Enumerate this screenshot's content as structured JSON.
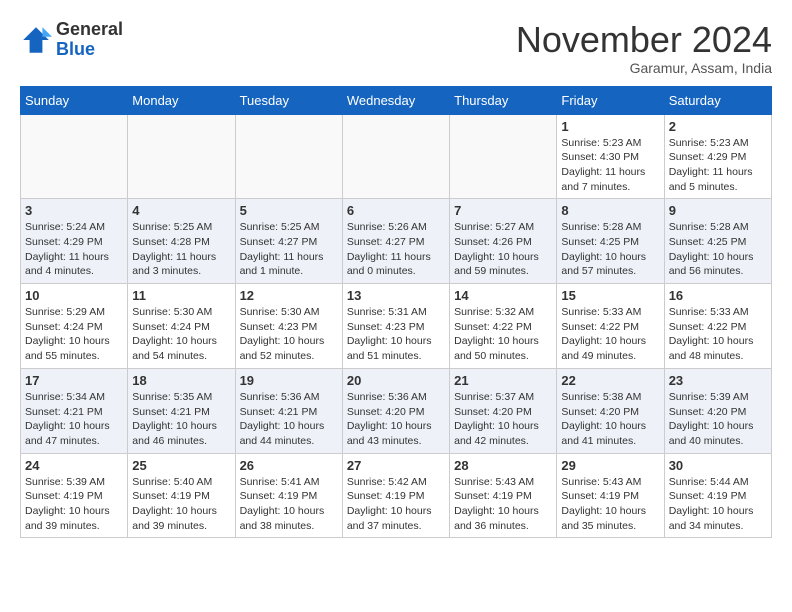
{
  "header": {
    "month_year": "November 2024",
    "location": "Garamur, Assam, India"
  },
  "columns": [
    "Sunday",
    "Monday",
    "Tuesday",
    "Wednesday",
    "Thursday",
    "Friday",
    "Saturday"
  ],
  "weeks": [
    [
      {
        "day": "",
        "info": ""
      },
      {
        "day": "",
        "info": ""
      },
      {
        "day": "",
        "info": ""
      },
      {
        "day": "",
        "info": ""
      },
      {
        "day": "",
        "info": ""
      },
      {
        "day": "1",
        "info": "Sunrise: 5:23 AM\nSunset: 4:30 PM\nDaylight: 11 hours and 7 minutes."
      },
      {
        "day": "2",
        "info": "Sunrise: 5:23 AM\nSunset: 4:29 PM\nDaylight: 11 hours and 5 minutes."
      }
    ],
    [
      {
        "day": "3",
        "info": "Sunrise: 5:24 AM\nSunset: 4:29 PM\nDaylight: 11 hours and 4 minutes."
      },
      {
        "day": "4",
        "info": "Sunrise: 5:25 AM\nSunset: 4:28 PM\nDaylight: 11 hours and 3 minutes."
      },
      {
        "day": "5",
        "info": "Sunrise: 5:25 AM\nSunset: 4:27 PM\nDaylight: 11 hours and 1 minute."
      },
      {
        "day": "6",
        "info": "Sunrise: 5:26 AM\nSunset: 4:27 PM\nDaylight: 11 hours and 0 minutes."
      },
      {
        "day": "7",
        "info": "Sunrise: 5:27 AM\nSunset: 4:26 PM\nDaylight: 10 hours and 59 minutes."
      },
      {
        "day": "8",
        "info": "Sunrise: 5:28 AM\nSunset: 4:25 PM\nDaylight: 10 hours and 57 minutes."
      },
      {
        "day": "9",
        "info": "Sunrise: 5:28 AM\nSunset: 4:25 PM\nDaylight: 10 hours and 56 minutes."
      }
    ],
    [
      {
        "day": "10",
        "info": "Sunrise: 5:29 AM\nSunset: 4:24 PM\nDaylight: 10 hours and 55 minutes."
      },
      {
        "day": "11",
        "info": "Sunrise: 5:30 AM\nSunset: 4:24 PM\nDaylight: 10 hours and 54 minutes."
      },
      {
        "day": "12",
        "info": "Sunrise: 5:30 AM\nSunset: 4:23 PM\nDaylight: 10 hours and 52 minutes."
      },
      {
        "day": "13",
        "info": "Sunrise: 5:31 AM\nSunset: 4:23 PM\nDaylight: 10 hours and 51 minutes."
      },
      {
        "day": "14",
        "info": "Sunrise: 5:32 AM\nSunset: 4:22 PM\nDaylight: 10 hours and 50 minutes."
      },
      {
        "day": "15",
        "info": "Sunrise: 5:33 AM\nSunset: 4:22 PM\nDaylight: 10 hours and 49 minutes."
      },
      {
        "day": "16",
        "info": "Sunrise: 5:33 AM\nSunset: 4:22 PM\nDaylight: 10 hours and 48 minutes."
      }
    ],
    [
      {
        "day": "17",
        "info": "Sunrise: 5:34 AM\nSunset: 4:21 PM\nDaylight: 10 hours and 47 minutes."
      },
      {
        "day": "18",
        "info": "Sunrise: 5:35 AM\nSunset: 4:21 PM\nDaylight: 10 hours and 46 minutes."
      },
      {
        "day": "19",
        "info": "Sunrise: 5:36 AM\nSunset: 4:21 PM\nDaylight: 10 hours and 44 minutes."
      },
      {
        "day": "20",
        "info": "Sunrise: 5:36 AM\nSunset: 4:20 PM\nDaylight: 10 hours and 43 minutes."
      },
      {
        "day": "21",
        "info": "Sunrise: 5:37 AM\nSunset: 4:20 PM\nDaylight: 10 hours and 42 minutes."
      },
      {
        "day": "22",
        "info": "Sunrise: 5:38 AM\nSunset: 4:20 PM\nDaylight: 10 hours and 41 minutes."
      },
      {
        "day": "23",
        "info": "Sunrise: 5:39 AM\nSunset: 4:20 PM\nDaylight: 10 hours and 40 minutes."
      }
    ],
    [
      {
        "day": "24",
        "info": "Sunrise: 5:39 AM\nSunset: 4:19 PM\nDaylight: 10 hours and 39 minutes."
      },
      {
        "day": "25",
        "info": "Sunrise: 5:40 AM\nSunset: 4:19 PM\nDaylight: 10 hours and 39 minutes."
      },
      {
        "day": "26",
        "info": "Sunrise: 5:41 AM\nSunset: 4:19 PM\nDaylight: 10 hours and 38 minutes."
      },
      {
        "day": "27",
        "info": "Sunrise: 5:42 AM\nSunset: 4:19 PM\nDaylight: 10 hours and 37 minutes."
      },
      {
        "day": "28",
        "info": "Sunrise: 5:43 AM\nSunset: 4:19 PM\nDaylight: 10 hours and 36 minutes."
      },
      {
        "day": "29",
        "info": "Sunrise: 5:43 AM\nSunset: 4:19 PM\nDaylight: 10 hours and 35 minutes."
      },
      {
        "day": "30",
        "info": "Sunrise: 5:44 AM\nSunset: 4:19 PM\nDaylight: 10 hours and 34 minutes."
      }
    ]
  ],
  "row_colors": [
    "#ffffff",
    "#eef2f8",
    "#ffffff",
    "#eef2f8",
    "#ffffff"
  ]
}
